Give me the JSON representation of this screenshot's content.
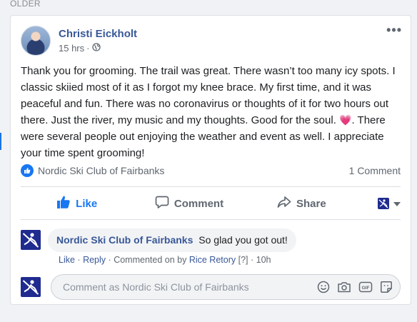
{
  "section": {
    "label": "OLDER"
  },
  "post": {
    "author": "Christi Eickholt",
    "time": "15 hrs",
    "separator": "·",
    "text_part1": "Thank you for grooming. The trail was great. There wasn’t too many icy spots. I classic skiied most of it as I forgot my knee brace. My first time, and it was peaceful and fun. There was no coronavirus or thoughts of it for two hours out there. Just the river, my music and my thoughts. Good for the soul. ",
    "text_part2": ". There were several people out enjoying the weather and event as well. I appreciate your time spent grooming!"
  },
  "reactions": {
    "liked_by": "Nordic Ski Club of Fairbanks",
    "comment_count": "1 Comment"
  },
  "actions": {
    "like": "Like",
    "comment": "Comment",
    "share": "Share"
  },
  "comment": {
    "author": "Nordic Ski Club of Fairbanks",
    "text": "So glad you got out!",
    "like": "Like",
    "reply": "Reply",
    "commented_on_by": "Commented on by",
    "commenter": "Rice Retory",
    "help": "[?]",
    "time": "10h",
    "sep": "·"
  },
  "compose": {
    "placeholder": "Comment as Nordic Ski Club of Fairbanks"
  },
  "colors": {
    "brand": "#1877f2",
    "link": "#385898",
    "club_logo": "#1f2b8f"
  },
  "icons": [
    "globe-icon",
    "more-icon",
    "heart-icon",
    "like-icon",
    "comment-icon",
    "share-icon",
    "chevron-down-icon",
    "emoji-icon",
    "camera-icon",
    "gif-icon",
    "sticker-icon"
  ]
}
